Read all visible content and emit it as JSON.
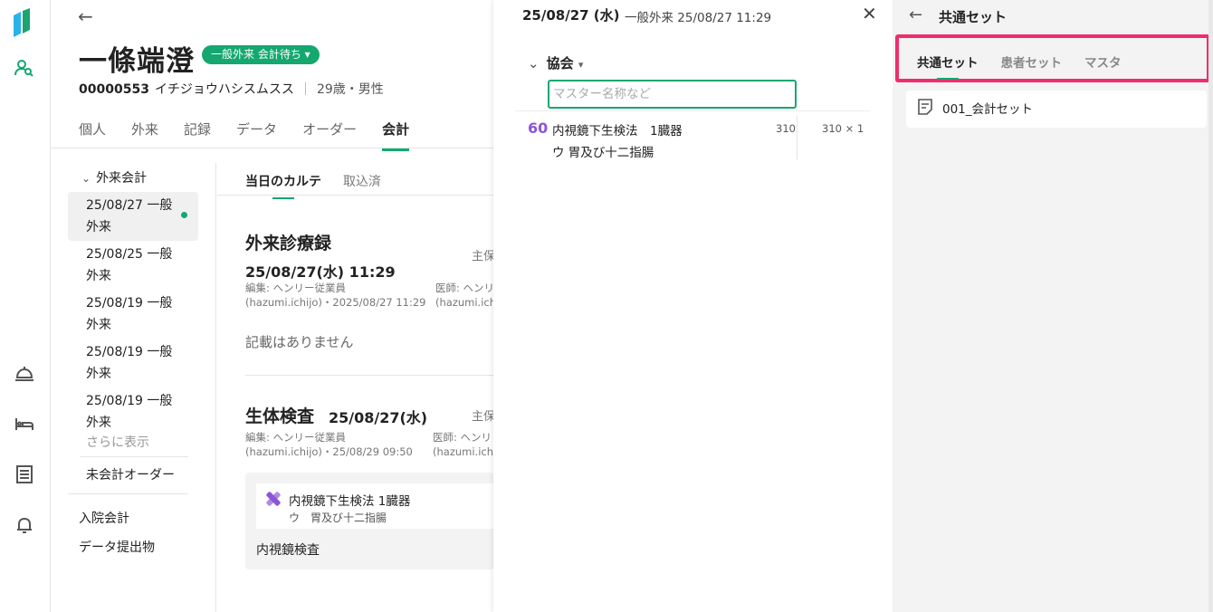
{
  "patient": {
    "name": "一條端澄",
    "status_badge": "一般外来 会計待ち",
    "id": "00000553",
    "kana": "イチジョウハシスムスス",
    "age_gender": "29歳・男性"
  },
  "tabs": [
    "個人",
    "外来",
    "記録",
    "データ",
    "オーダー",
    "会計"
  ],
  "accounting": {
    "header": "外来会計",
    "items": [
      "25/08/27 一般外来",
      "25/08/25 一般外来",
      "25/08/19 一般外来",
      "25/08/19 一般外来",
      "25/08/19 一般外来"
    ],
    "more": "さらに表示",
    "unpaid": "未会計オーダー",
    "inpatient": "入院会計",
    "data_submission": "データ提出物"
  },
  "karte": {
    "subtabs": [
      "当日のカルテ",
      "取込済"
    ],
    "outpatient": {
      "title": "外来診療録",
      "date": "25/08/27(水) 11:29",
      "insurance_label": "主保",
      "editor_line1": "編集: ヘンリー従業員",
      "editor_line2": "(hazumi.ichijo)・2025/08/27 11:29",
      "doctor_line1": "医師: ヘンリ",
      "doctor_line2": "(hazumi.ichi",
      "empty": "記載はありません"
    },
    "biopsy": {
      "title": "生体検査",
      "date": "25/08/27(水)",
      "insurance_label": "主保",
      "editor_line1": "編集: ヘンリー従業員",
      "editor_line2": "(hazumi.ichijo)・25/08/29 09:50",
      "doctor_line1": "医師: ヘンリ",
      "doctor_line2": "(hazumi.ichi",
      "item_name": "内視鏡下生検法 1臓器",
      "item_sub": "ウ　胃及び十二指腸",
      "footer": "内視鏡検査"
    }
  },
  "middle": {
    "date": "25/08/27 (水)",
    "subtitle": "一般外来 25/08/27 11:29",
    "group": "協会",
    "search_placeholder": "マスター名称など",
    "item": {
      "points": "60",
      "name": "内視鏡下生検法　1臓器",
      "sub": "ウ 胃及び十二指腸",
      "unit_points": "310",
      "quantity": "310 × 1"
    }
  },
  "right": {
    "title": "共通セット",
    "tabs": [
      "共通セット",
      "患者セット",
      "マスタ"
    ],
    "list": [
      "001_会計セット"
    ]
  },
  "colors": {
    "accent": "#14a86f",
    "highlight": "#ee2e6b",
    "points": "#8b56d6"
  }
}
